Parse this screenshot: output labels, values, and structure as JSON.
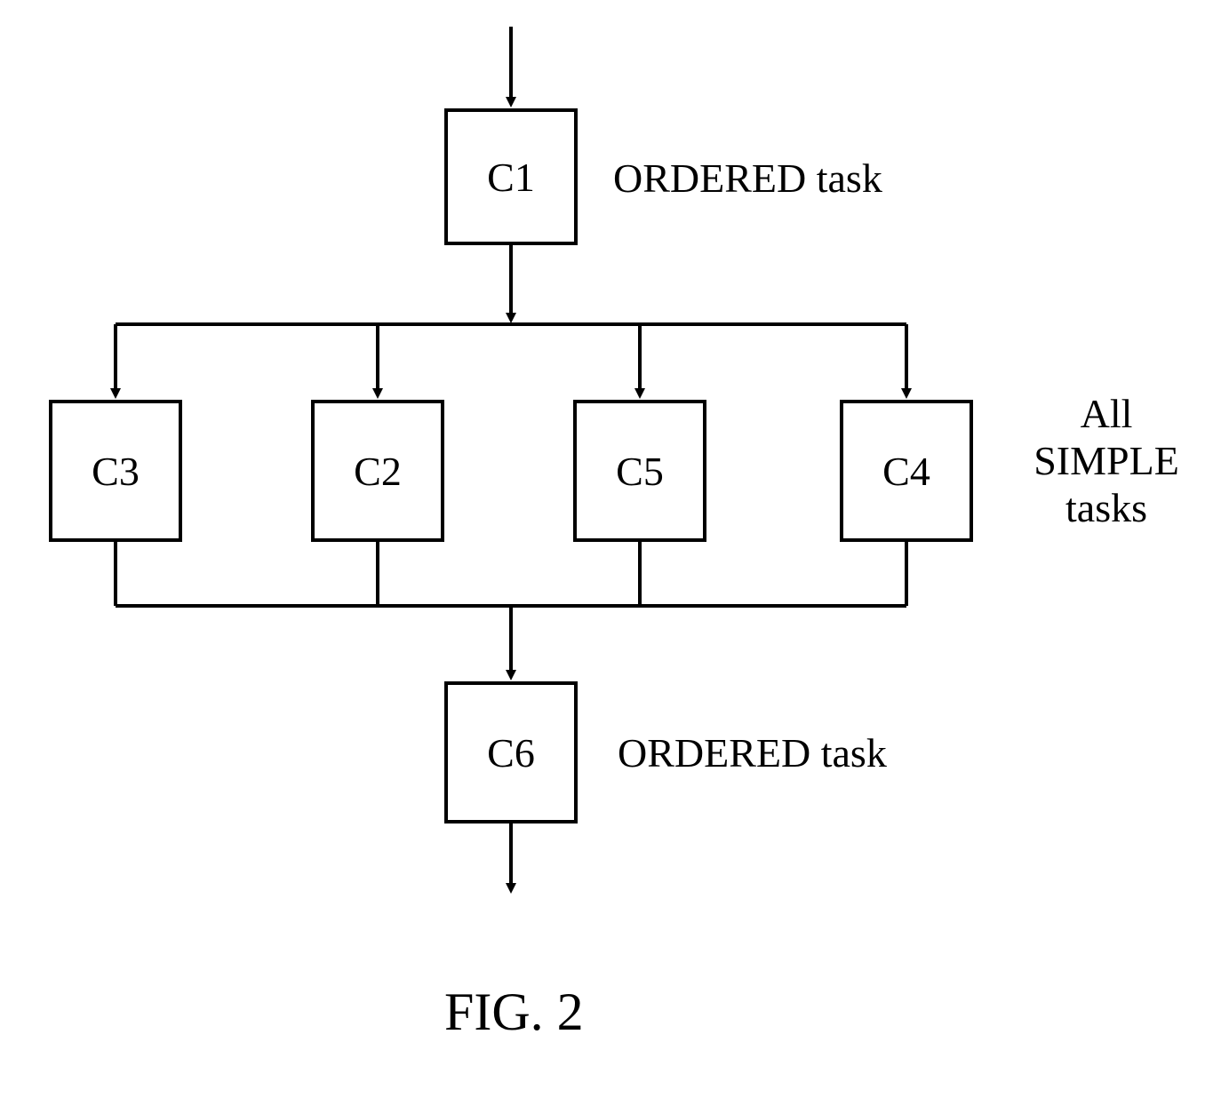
{
  "nodes": {
    "c1": "C1",
    "c2": "C2",
    "c3": "C3",
    "c4": "C4",
    "c5": "C5",
    "c6": "C6"
  },
  "labels": {
    "topOrdered": "ORDERED task",
    "simpleLine1": "All",
    "simpleLine2": "SIMPLE",
    "simpleLine3": "tasks",
    "bottomOrdered": "ORDERED task"
  },
  "caption": "FIG. 2"
}
